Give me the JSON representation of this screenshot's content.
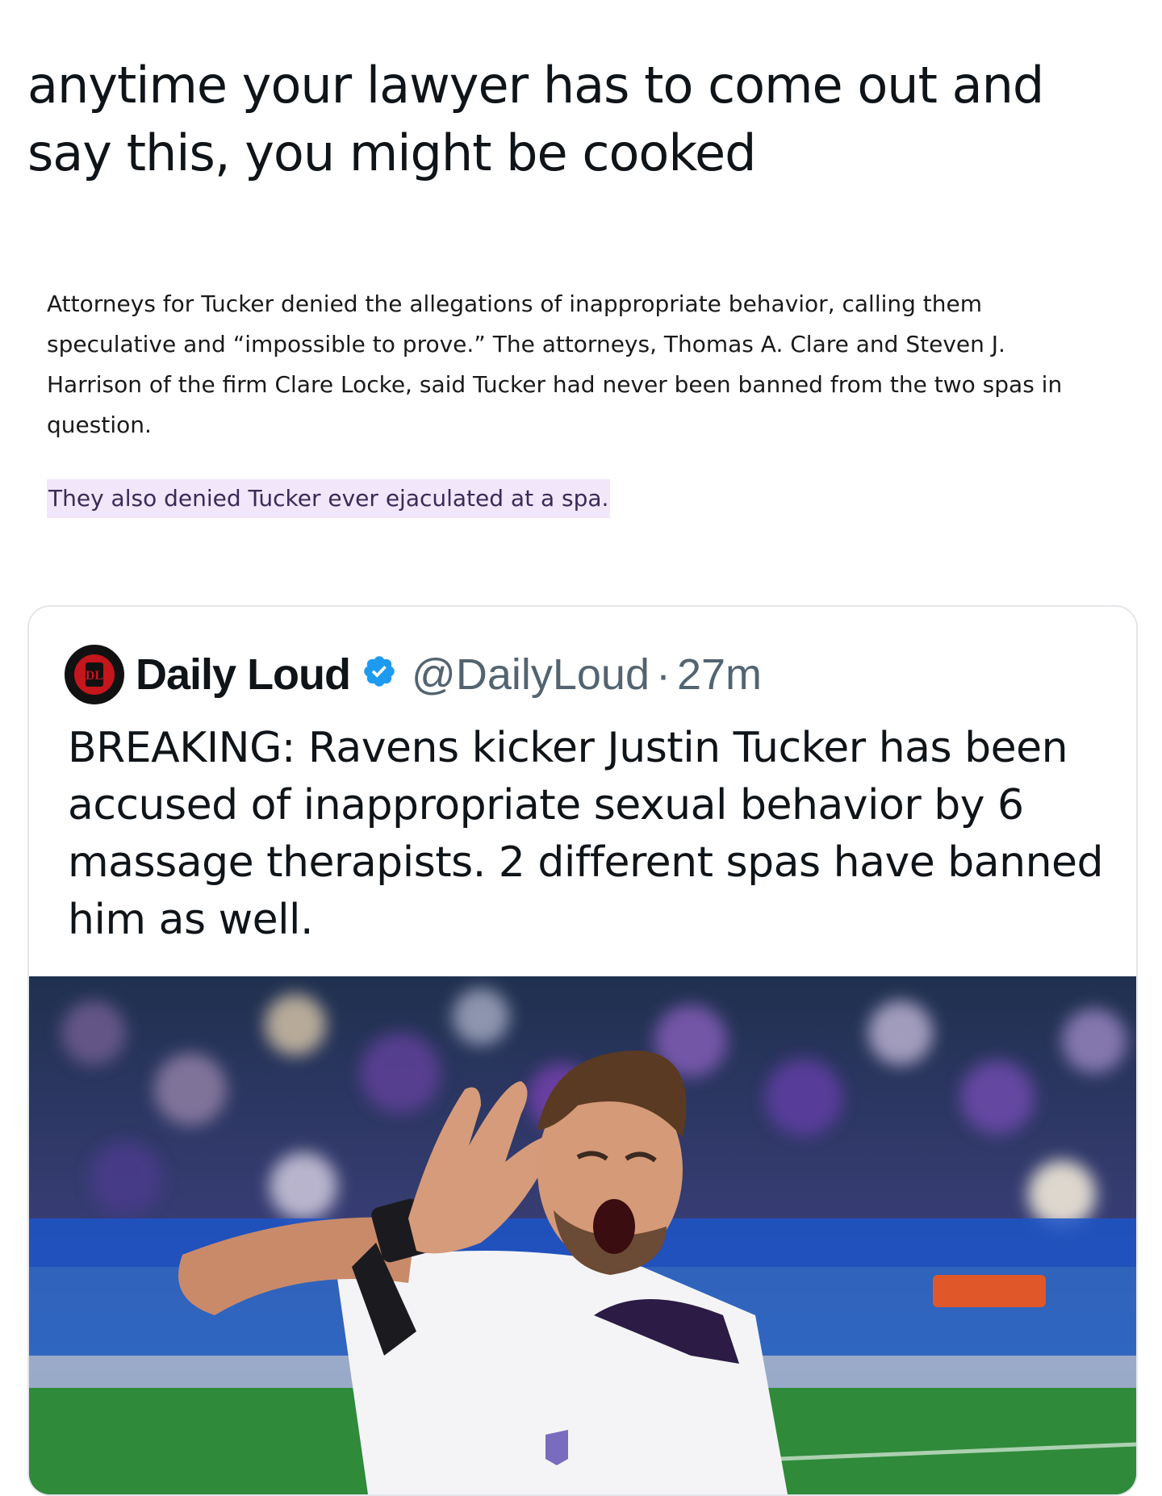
{
  "post": {
    "text": "anytime your lawyer has to come out and say this, you might be cooked"
  },
  "article_excerpt": {
    "paragraph": "Attorneys for Tucker denied the allegations of inappropriate behavior, calling them speculative and “impossible to prove.” The attorneys, Thomas A. Clare and Steven J. Harrison of the firm Clare Locke, said Tucker had never been banned from the two spas in question.",
    "highlight": "They also denied Tucker ever ejaculated at a spa.",
    "highlight_color": "#f1e6fa"
  },
  "quoted_tweet": {
    "author_name": "Daily Loud",
    "verified": true,
    "verified_color": "#1d9bf0",
    "handle": "@DailyLoud",
    "separator": "·",
    "time": "27m",
    "avatar_icon": "daily-loud-logo-icon",
    "text": "BREAKING: Ravens kicker Justin Tucker has been accused of inappropriate sexual behavior by 6 massage therapists. 2 different spas have banned him as well.",
    "media": {
      "type": "photo",
      "subject": "football-player-celebrating-photo"
    }
  }
}
